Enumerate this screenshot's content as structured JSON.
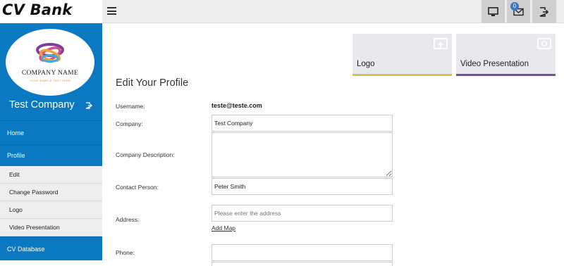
{
  "brand": {
    "title": "CV Bank"
  },
  "topbar": {
    "menu_icon": "hamburger-icon",
    "buttons": [
      {
        "name": "monitor",
        "icon": "monitor-icon"
      },
      {
        "name": "messages",
        "icon": "envelope-icon",
        "badge": "0"
      },
      {
        "name": "logout",
        "icon": "logout-icon"
      }
    ]
  },
  "sidebar": {
    "logo": {
      "company_name": "COMPANY NAME",
      "slogan": "YOUR SAMPLE TEXT HERE"
    },
    "company": "Test Company",
    "items": [
      {
        "label": "Home"
      },
      {
        "label": "Profile"
      }
    ],
    "subitems": [
      {
        "label": "Edit"
      },
      {
        "label": "Change Password"
      },
      {
        "label": "Logo"
      },
      {
        "label": "Video Presentation"
      }
    ],
    "bottom_item": {
      "label": "CV Database"
    }
  },
  "cards": [
    {
      "label": "Logo",
      "icon": "image-upload-icon",
      "accent": "#d9c14f"
    },
    {
      "label": "Video Presentation",
      "icon": "video-icon",
      "accent": "#7b4fa0"
    }
  ],
  "form": {
    "title": "Edit Your Profile",
    "username_label": "Username:",
    "username_value": "teste@teste.com",
    "company_label": "Company:",
    "company_value": "Test Company",
    "description_label": "Company Description:",
    "description_value": "",
    "contact_label": "Contact Person:",
    "contact_value": "Peter Smith",
    "address_label": "Address:",
    "address_placeholder": "Please enter the address",
    "add_map": "Add Map",
    "phone_label": "Phone:",
    "phone_value": ""
  },
  "colors": {
    "sidebar_blue": "#0b79c2",
    "topbar": "#ededed"
  }
}
